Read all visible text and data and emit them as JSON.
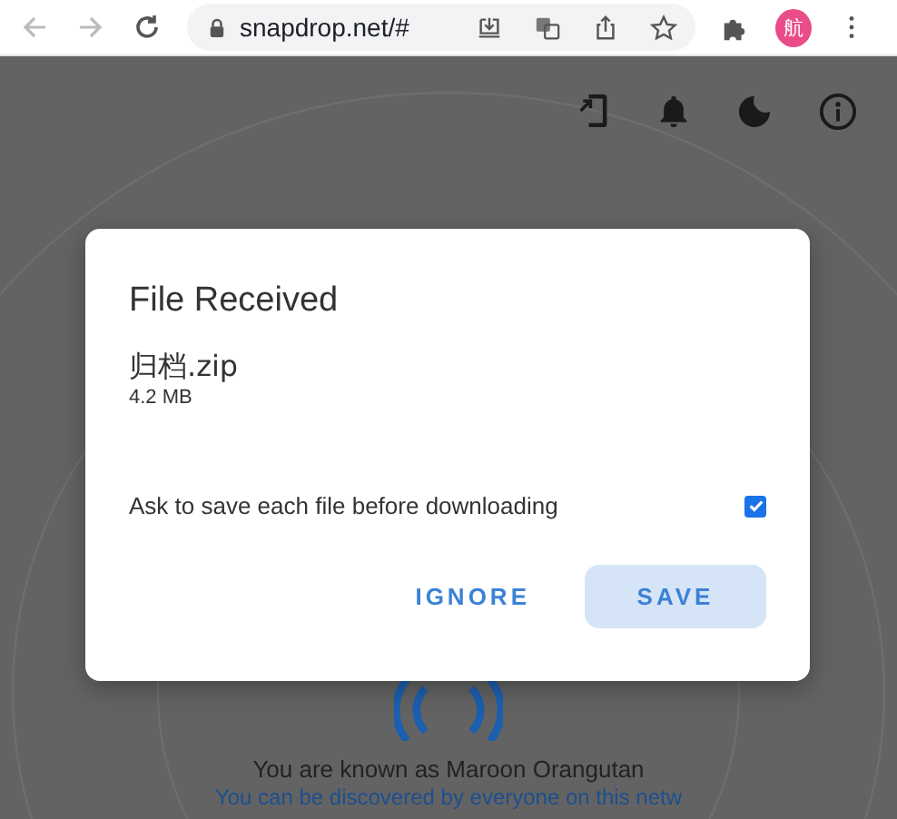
{
  "browser": {
    "url": "snapdrop.net/#",
    "profile_initial": "航"
  },
  "dialog": {
    "title": "File Received",
    "file_name": "归档.zip",
    "file_size": "4.2 MB",
    "option": {
      "label": "Ask to save each file before downloading",
      "checked": true
    },
    "buttons": [
      {
        "label": "IGNORE",
        "kind": "text"
      },
      {
        "label": "SAVE",
        "kind": "filled"
      }
    ]
  },
  "footer": {
    "name_line": "You are known as Maroon Orangutan",
    "discover_line": "You can be discovered by everyone on this netw"
  }
}
